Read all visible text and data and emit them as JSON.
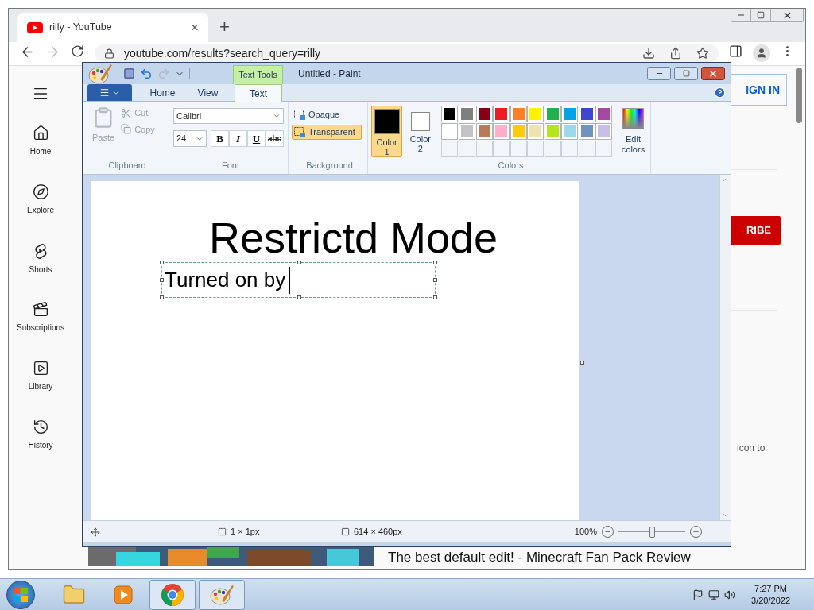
{
  "browser": {
    "tab": {
      "title": "rilly - YouTube",
      "close": "×"
    },
    "new_tab": "+",
    "address": "youtube.com/results?search_query=rilly"
  },
  "youtube": {
    "sidebar": [
      {
        "kind": "home",
        "label": "Home"
      },
      {
        "kind": "explore",
        "label": "Explore"
      },
      {
        "kind": "shorts",
        "label": "Shorts"
      },
      {
        "kind": "subscriptions",
        "label": "Subscriptions"
      },
      {
        "kind": "library",
        "label": "Library"
      },
      {
        "kind": "history",
        "label": "History"
      }
    ],
    "sign_in": "IGN IN",
    "subscribe": "RIBE",
    "snippet": "icon to",
    "video_title": "The best default edit! - Minecraft Fan Pack Review"
  },
  "paint": {
    "title": "Untitled - Paint",
    "contextual_tab": "Text Tools",
    "tabs": [
      {
        "label": "Home",
        "selected": false
      },
      {
        "label": "View",
        "selected": false
      },
      {
        "label": "Text",
        "selected": true
      }
    ],
    "clipboard": {
      "label": "Clipboard",
      "paste": "Paste",
      "cut": "Cut",
      "copy": "Copy",
      "disabled": true
    },
    "font": {
      "label": "Font",
      "family": "Calibri",
      "size": "24",
      "styles": [
        {
          "kind": "bold",
          "label": "B",
          "selected": false
        },
        {
          "kind": "italic",
          "label": "I",
          "selected": false
        },
        {
          "kind": "underline",
          "label": "U",
          "selected": false
        },
        {
          "kind": "strike",
          "label": "abc",
          "selected": false
        }
      ]
    },
    "background": {
      "label": "Background",
      "options": [
        {
          "label": "Opaque",
          "selected": false
        },
        {
          "label": "Transparent",
          "selected": true
        }
      ]
    },
    "colors": {
      "label": "Colors",
      "slots": [
        {
          "label": "Color",
          "number": "1",
          "color": "#000000",
          "selected": true
        },
        {
          "label": "Color",
          "number": "2",
          "color": "#ffffff",
          "selected": false
        }
      ],
      "palette": [
        {
          "color": "#000000"
        },
        {
          "color": "#7f7f7f"
        },
        {
          "color": "#880015"
        },
        {
          "color": "#ed1c24"
        },
        {
          "color": "#ff7f27"
        },
        {
          "color": "#fff200"
        },
        {
          "color": "#22b14c"
        },
        {
          "color": "#00a2e8"
        },
        {
          "color": "#3f48cc"
        },
        {
          "color": "#a349a4"
        },
        {
          "color": "#ffffff"
        },
        {
          "color": "#c3c3c3"
        },
        {
          "color": "#b97a57"
        },
        {
          "color": "#ffaec9"
        },
        {
          "color": "#ffc90e"
        },
        {
          "color": "#efe4b0"
        },
        {
          "color": "#b5e61d"
        },
        {
          "color": "#99d9ea"
        },
        {
          "color": "#7092be"
        },
        {
          "color": "#c8bfe7"
        }
      ],
      "edit": "Edit colors"
    },
    "canvas": {
      "heading": "Restrictd Mode",
      "text_box": "Turned on by"
    },
    "status": {
      "selection": "1 × 1px",
      "size": "614 × 460px",
      "zoom": "100%",
      "level": 0.5
    }
  },
  "taskbar": {
    "apps": [
      {
        "kind": "folder",
        "running": false
      },
      {
        "kind": "media",
        "running": false
      },
      {
        "kind": "chrome",
        "running": true
      },
      {
        "kind": "paint",
        "running": true
      }
    ],
    "time": "7:27 PM",
    "date": "3/20/2022"
  }
}
